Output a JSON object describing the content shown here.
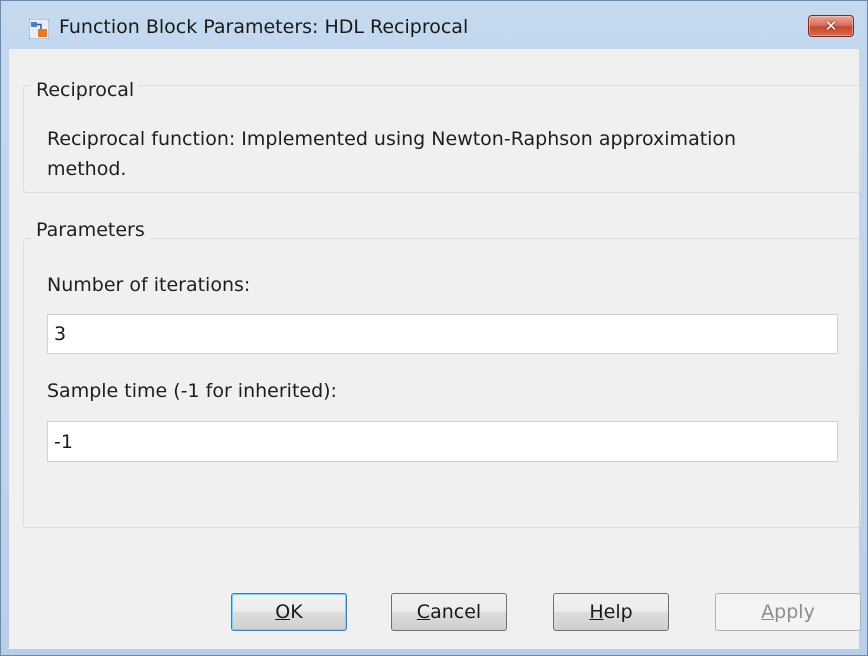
{
  "window": {
    "title": "Function Block Parameters: HDL Reciprocal",
    "icon": "simulink-block-icon",
    "close_label": "✕"
  },
  "reciprocal_group": {
    "title": "Reciprocal",
    "description": "Reciprocal function: Implemented using Newton-Raphson approximation method."
  },
  "parameters_group": {
    "title": "Parameters",
    "iterations_label": "Number of iterations:",
    "iterations_value": "3",
    "sample_time_label": "Sample time (-1 for inherited):",
    "sample_time_value": "-1"
  },
  "buttons": {
    "ok": {
      "mnemonic": "O",
      "rest": "K"
    },
    "cancel": {
      "mnemonic": "C",
      "rest": "ancel"
    },
    "help": {
      "mnemonic": "H",
      "rest": "elp"
    },
    "apply": {
      "mnemonic": "A",
      "rest": "pply",
      "enabled": false
    }
  },
  "colors": {
    "titlebar": "#b9d1ea",
    "close_button": "#c44b31",
    "default_button_border": "#3c7fb1"
  }
}
